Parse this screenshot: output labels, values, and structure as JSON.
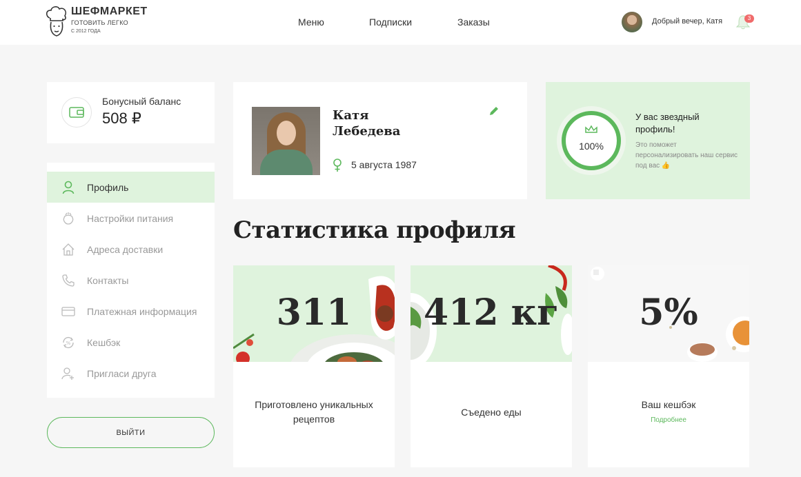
{
  "header": {
    "logo": {
      "name": "ШЕФМАРКЕТ",
      "tagline": "ГОТОВИТЬ ЛЕГКО",
      "since": "С 2012 ГОДА"
    },
    "nav": [
      {
        "label": "Меню"
      },
      {
        "label": "Подписки"
      },
      {
        "label": "Заказы"
      }
    ],
    "greeting": "Добрый вечер, Катя",
    "notifications_count": "3"
  },
  "bonus": {
    "label": "Бонусный баланс",
    "value": "508 ₽"
  },
  "sidebar": {
    "items": [
      {
        "label": "Профиль",
        "icon": "user-icon",
        "active": true
      },
      {
        "label": "Настройки питания",
        "icon": "food-icon"
      },
      {
        "label": "Адреса доставки",
        "icon": "house-icon"
      },
      {
        "label": "Контакты",
        "icon": "phone-icon"
      },
      {
        "label": "Платежная информация",
        "icon": "card-icon"
      },
      {
        "label": "Кешбэк",
        "icon": "cashback-icon"
      },
      {
        "label": "Пригласи друга",
        "icon": "invite-icon"
      }
    ],
    "logout_label": "ВЫЙТИ"
  },
  "profile": {
    "first_name": "Катя",
    "last_name": "Лебедева",
    "birthday": "5 августа 1987"
  },
  "star_profile": {
    "percent": "100%",
    "progress": 1.0,
    "title": "У вас звездный профиль!",
    "subtitle": "Это поможет персонализировать наш сервис под вас 👍"
  },
  "stats": {
    "heading": "Статистика профиля",
    "cards": [
      {
        "value": "311",
        "label": "Приготовлено уникальных рецептов"
      },
      {
        "value": "412 кг",
        "label": "Съедено еды"
      },
      {
        "value": "5%",
        "label": "Ваш кешбэк",
        "link": "Подробнее"
      }
    ]
  },
  "colors": {
    "accent": "#5cb85c",
    "accent_light": "#dff3dd",
    "badge": "#f06b6b"
  }
}
